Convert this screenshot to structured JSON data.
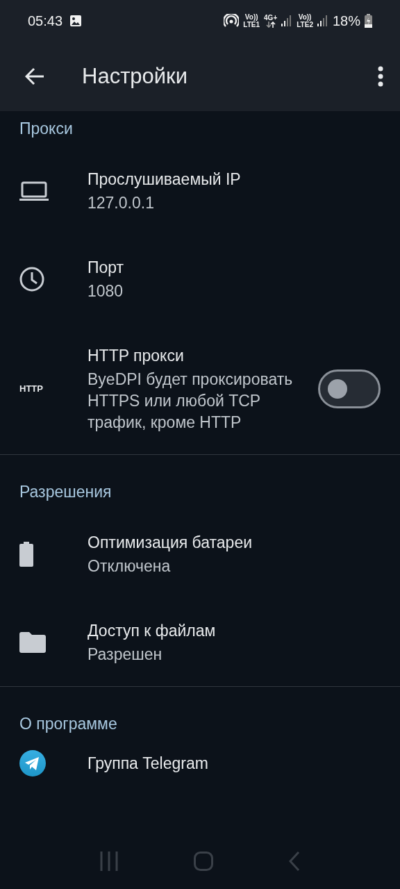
{
  "status_bar": {
    "time": "05:43",
    "sim1": {
      "volte": "Vo))",
      "network": "LTE1"
    },
    "data": {
      "network": "4G+"
    },
    "sim2": {
      "volte": "Vo))",
      "network": "LTE2"
    },
    "battery": "18%"
  },
  "app_bar": {
    "title": "Настройки"
  },
  "sections": [
    {
      "title": "Прокси",
      "items": [
        {
          "kind": "value",
          "title": "Прослушиваемый IP",
          "summary": "127.0.0.1"
        },
        {
          "kind": "value",
          "title": "Порт",
          "summary": "1080"
        },
        {
          "kind": "switch",
          "icon_text": "HTTP",
          "title": "HTTP прокси",
          "summary": "ByeDPI будет проксировать HTTPS или любой TCP трафик, кроме HTTP",
          "on": false
        }
      ]
    },
    {
      "title": "Разрешения",
      "items": [
        {
          "kind": "value",
          "title": "Оптимизация батареи",
          "summary": "Отключена"
        },
        {
          "kind": "value",
          "title": "Доступ к файлам",
          "summary": "Разрешен"
        }
      ]
    },
    {
      "title": "О программе",
      "items": [
        {
          "kind": "link",
          "title": "Группа Telegram"
        }
      ]
    }
  ]
}
